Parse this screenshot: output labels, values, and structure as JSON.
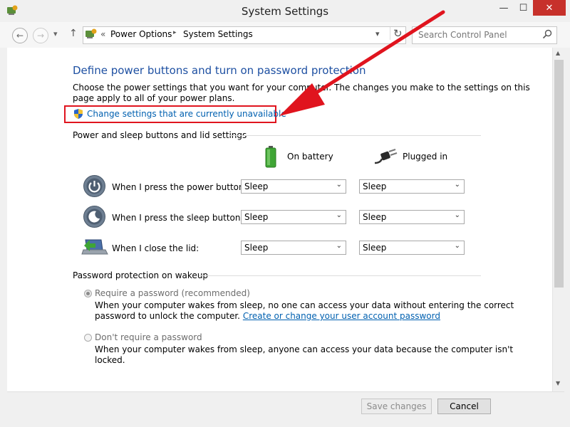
{
  "window": {
    "title": "System Settings",
    "minimize": "—",
    "maximize": "☐",
    "close": "✕"
  },
  "address": {
    "back": "←",
    "forward": "→",
    "recent": "▾",
    "up": "↑",
    "sep": "«",
    "crumb1": "Power Options",
    "arrow": "▸",
    "crumb2": "System Settings",
    "dropdown": "▾",
    "refresh": "↻"
  },
  "search": {
    "placeholder": "Search Control Panel",
    "icon": "⌕"
  },
  "page": {
    "heading": "Define power buttons and turn on password protection",
    "intro_line1": "Choose the power settings that you want for your computer. The changes you make to the settings on this",
    "intro_line2": "page apply to all of your power plans.",
    "change_link": "Change settings that are currently unavailable"
  },
  "power_section": {
    "title": "Power and sleep buttons and lid settings",
    "col_battery": "On battery",
    "col_plugged": "Plugged in",
    "rows": [
      {
        "label": "When I press the power button:",
        "battery": "Sleep",
        "plugged": "Sleep"
      },
      {
        "label": "When I press the sleep button:",
        "battery": "Sleep",
        "plugged": "Sleep"
      },
      {
        "label": "When I close the lid:",
        "battery": "Sleep",
        "plugged": "Sleep"
      }
    ]
  },
  "password_section": {
    "title": "Password protection on wakeup",
    "opt1_label": "Require a password (recommended)",
    "opt1_desc_line1": "When your computer wakes from sleep, no one can access your data without entering the correct",
    "opt1_desc_line2": "password to unlock the computer.",
    "opt1_link": "Create or change your user account password",
    "opt2_label": "Don't require a password",
    "opt2_desc_line1": "When your computer wakes from sleep, anyone can access your data because the computer isn't",
    "opt2_desc_line2": "locked."
  },
  "footer": {
    "save": "Save changes",
    "cancel": "Cancel"
  },
  "colors": {
    "heading": "#1e50a2",
    "link": "#0060b0",
    "highlight": "#e0141e",
    "close": "#c7312b"
  }
}
